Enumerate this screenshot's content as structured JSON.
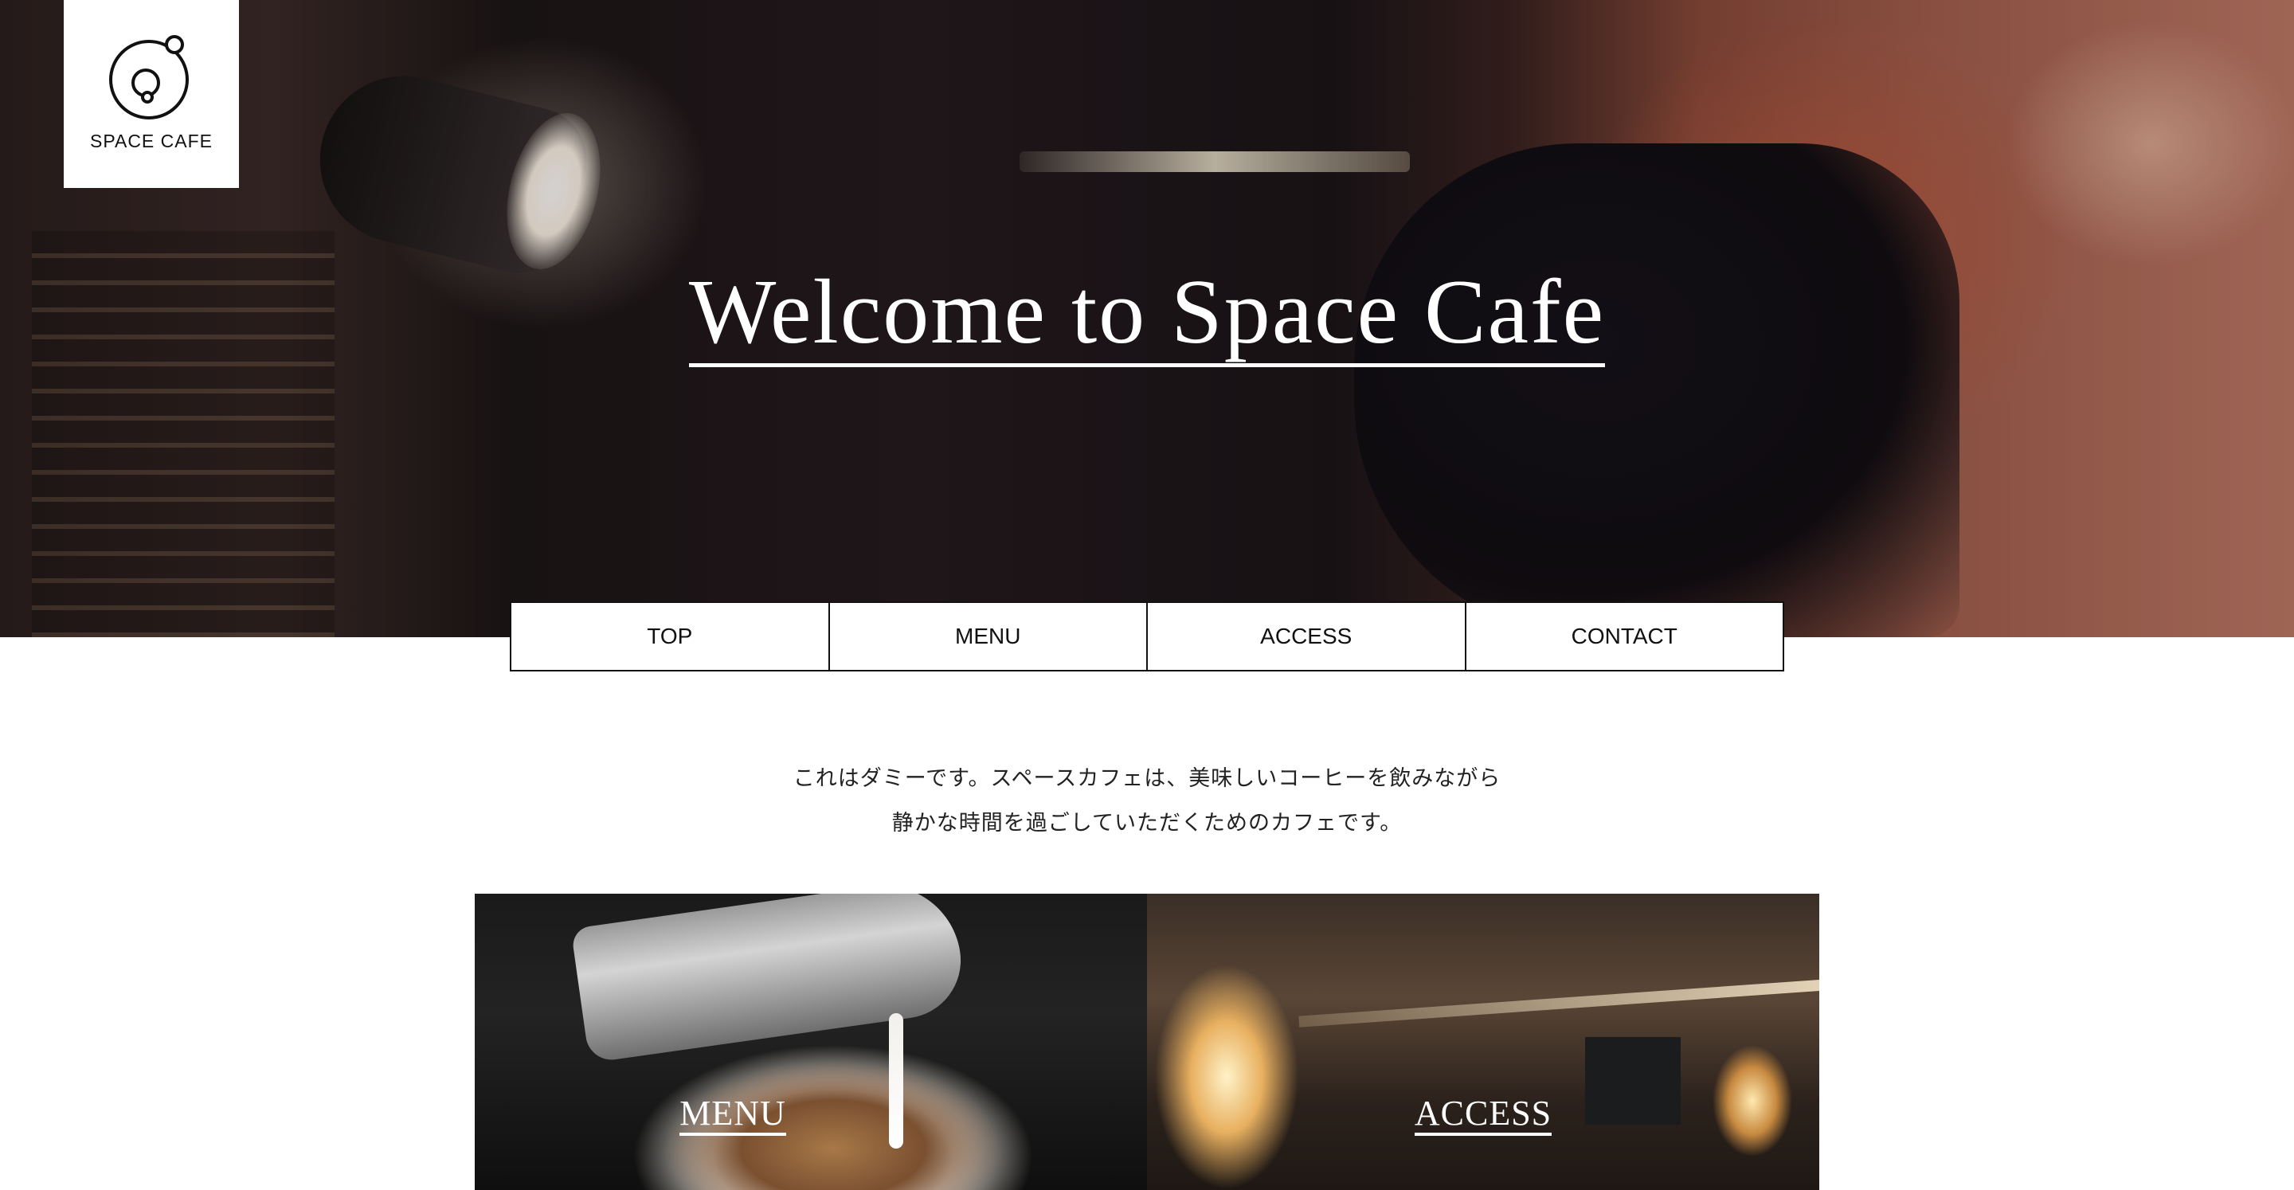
{
  "brand": {
    "name": "SPACE CAFE",
    "logo_icon": "planet-orbit-icon"
  },
  "hero": {
    "title": "Welcome to Space Cafe"
  },
  "nav": {
    "items": [
      {
        "label": "TOP"
      },
      {
        "label": "MENU"
      },
      {
        "label": "ACCESS"
      },
      {
        "label": "CONTACT"
      }
    ]
  },
  "intro": {
    "line1": "これはダミーです。スペースカフェは、美味しいコーヒーを飲みながら",
    "line2": "静かな時間を過ごしていただくためのカフェです。"
  },
  "cards": [
    {
      "label": "MENU"
    },
    {
      "label": "ACCESS"
    }
  ],
  "colors": {
    "nav_border": "#111111",
    "background": "#ffffff",
    "hero_text": "#ffffff"
  }
}
